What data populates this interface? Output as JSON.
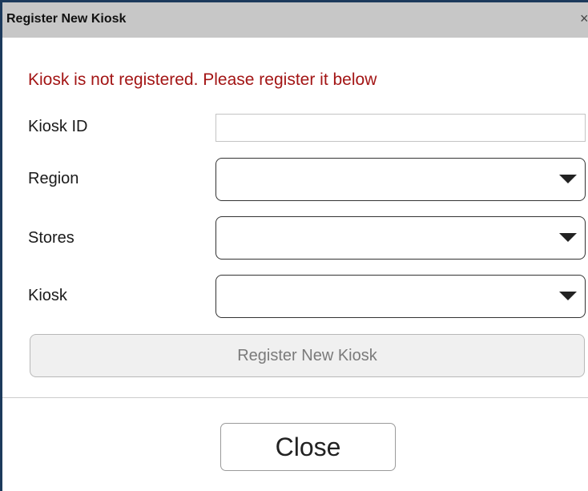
{
  "window": {
    "title": "Register New Kiosk",
    "close_glyph": "×"
  },
  "message": "Kiosk is not registered. Please register it below",
  "colors": {
    "message": "#a31515",
    "window_border": "#1c3a5c",
    "titlebar": "#c7c7c7"
  },
  "form": {
    "kiosk_id": {
      "label": "Kiosk ID",
      "value": ""
    },
    "region": {
      "label": "Region",
      "value": "",
      "icon": "dropdown-arrow-icon"
    },
    "stores": {
      "label": "Stores",
      "value": "",
      "icon": "dropdown-arrow-icon"
    },
    "kiosk": {
      "label": "Kiosk",
      "value": "",
      "icon": "dropdown-arrow-icon"
    }
  },
  "buttons": {
    "register": "Register New Kiosk",
    "close": "Close"
  }
}
